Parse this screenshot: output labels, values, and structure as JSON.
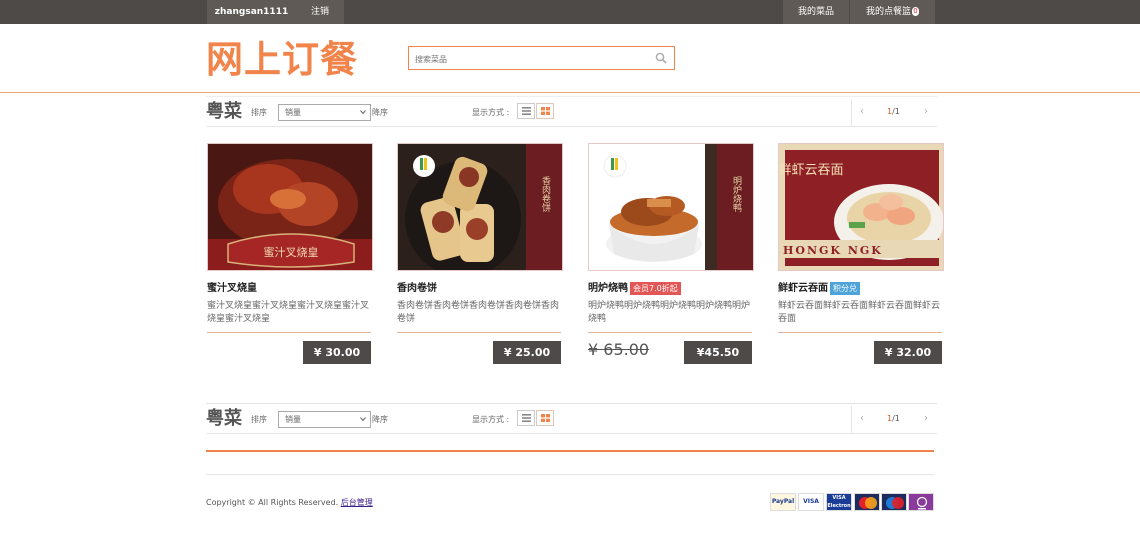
{
  "topbar": {
    "username": "zhangsan1111",
    "logout": "注销",
    "my_dishes": "我的菜品",
    "my_basket": "我的点餐篮",
    "basket_count": "0"
  },
  "header": {
    "logo": "网上订餐",
    "search_placeholder": "搜索菜品",
    "search_icon": "search-icon"
  },
  "filter": {
    "category": "粤菜",
    "sort_label": "排序",
    "sort_value": "销量",
    "order_label": "降序",
    "view_label": "显示方式 :",
    "page_current": "1",
    "page_total": "/1",
    "prev": "‹",
    "next": "›"
  },
  "products": [
    {
      "name": "蜜汁叉烧皇",
      "tag": "",
      "desc": "蜜汁叉烧皇蜜汁叉烧皇蜜汁叉烧皇蜜汁叉烧皇蜜汁叉烧皇",
      "old_price": "",
      "price": "¥ 30.00",
      "image_caption": "蜜汁叉烧皇"
    },
    {
      "name": "香肉卷饼",
      "tag": "",
      "desc": "香肉卷饼香肉卷饼香肉卷饼香肉卷饼香肉卷饼",
      "old_price": "",
      "price": "¥ 25.00",
      "image_caption": "香肉卷饼"
    },
    {
      "name": "明炉烧鸭",
      "tag": "会员7.0折起",
      "desc": "明炉烧鸭明炉烧鸭明炉烧鸭明炉烧鸭明炉烧鸭",
      "old_price": "¥ 65.00",
      "price": "¥45.50",
      "image_caption": "明炉烧鸭"
    },
    {
      "name": "鲜虾云吞面",
      "tag": "积分兑",
      "desc": "鲜虾云吞面鲜虾云吞面鲜虾云吞面鲜虾云吞面",
      "old_price": "",
      "price": "¥ 32.00",
      "image_caption": "鲜虾云吞面"
    }
  ],
  "footer": {
    "copyright": "Copyright © All Rights Reserved.",
    "admin_link": "后台管理",
    "payments": [
      "PayPal",
      "VISA",
      "VISA Electron",
      "MasterCard",
      "Maestro",
      "other"
    ]
  },
  "colors": {
    "accent": "#f0844b",
    "topbar": "#4e4a47",
    "tag_red": "#e25656",
    "tag_blue": "#4ea3d9"
  }
}
